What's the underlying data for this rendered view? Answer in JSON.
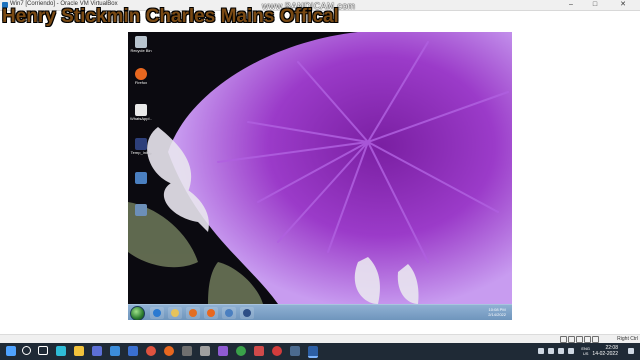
{
  "vbox": {
    "window_title": "Win7 [Corriendo] - Oracle VM VirtualBox",
    "minimize": "–",
    "maximize": "□",
    "close": "✕",
    "host_key": "Right Ctrl"
  },
  "recording": {
    "bandicam_watermark": "www.BANDICAM.com"
  },
  "overlay": {
    "text": "Henry Stickmin Charles Mains Offical"
  },
  "guest": {
    "desktop_icons": [
      {
        "label": "Recycle Bin",
        "icon": "recycle-bin-icon",
        "color": "#b8c4cf"
      },
      {
        "label": "Firefox",
        "icon": "firefox-icon",
        "color": "#e8671f"
      },
      {
        "label": "WhatsAppI...",
        "icon": "document-icon",
        "color": "#e9e9e9"
      },
      {
        "label": "Temp_Init...",
        "icon": "file-icon",
        "color": "#2d3f7a"
      },
      {
        "label": "",
        "icon": "windows-flag-icon",
        "color": "#4a7fc0"
      },
      {
        "label": "",
        "icon": "app-icon",
        "color": "#6c8fb8"
      }
    ],
    "taskbar": {
      "pinned": [
        {
          "icon": "ie-icon",
          "color": "#2b7ad1"
        },
        {
          "icon": "explorer-folder-icon",
          "color": "#e7c35b"
        },
        {
          "icon": "media-player-icon",
          "color": "#e36e23"
        },
        {
          "icon": "firefox-icon",
          "color": "#e8671f"
        },
        {
          "icon": "windows-flag-icon",
          "color": "#4a7fc0"
        },
        {
          "icon": "virtualbox-app-icon",
          "color": "#2d4e86"
        }
      ],
      "time": "10:08 PM",
      "date": "2/14/2022"
    }
  },
  "host": {
    "taskbar_icons": [
      {
        "icon": "windows-start-icon",
        "color": "#4fa3ff"
      },
      {
        "icon": "search-icon",
        "color": "#ffffff"
      },
      {
        "icon": "task-view-icon",
        "color": "#ffffff"
      },
      {
        "icon": "edge-icon",
        "color": "#2fbcd8"
      },
      {
        "icon": "file-explorer-icon",
        "color": "#f1c23c"
      },
      {
        "icon": "store-icon",
        "color": "#5c6fd6"
      },
      {
        "icon": "photos-icon",
        "color": "#3c8ddb"
      },
      {
        "icon": "mail-icon",
        "color": "#3a6fd0"
      },
      {
        "icon": "chrome-icon",
        "color": "#e0533f"
      },
      {
        "icon": "firefox-icon",
        "color": "#e8671f"
      },
      {
        "icon": "terminal-icon",
        "color": "#6f6f6f"
      },
      {
        "icon": "settings-icon",
        "color": "#a0a0a0"
      },
      {
        "icon": "app-icon",
        "color": "#8f5bd3"
      },
      {
        "icon": "xbox-icon",
        "color": "#3aa24a"
      },
      {
        "icon": "calendar-icon",
        "color": "#d04a4a"
      },
      {
        "icon": "bandicam-icon",
        "color": "#d23c3c"
      },
      {
        "icon": "steam-icon",
        "color": "#4b6a8f"
      },
      {
        "icon": "virtualbox-icon",
        "color": "#2d5fa5"
      }
    ],
    "lang_line1": "ENG",
    "lang_line2": "US",
    "time": "22:08",
    "date": "14-02-2022"
  }
}
